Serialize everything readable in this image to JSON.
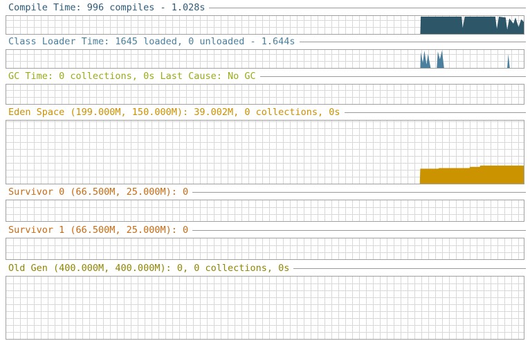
{
  "theme": {
    "grid_color": "#d8d8d8",
    "frame_color": "#a0a0a0"
  },
  "panels": [
    {
      "id": "compile-time",
      "title": "Compile Time: 996 compiles - 1.028s",
      "title_color": "#2d5a78",
      "fill_color": "#2e5669",
      "series": {
        "kind": "spikes",
        "description_note": "",
        "segments": [
          [
            0.0,
            0.0
          ],
          [
            0.8,
            0.0
          ],
          [
            0.801,
            1.0
          ],
          [
            0.88,
            1.0
          ],
          [
            0.882,
            0.35
          ],
          [
            0.886,
            1.0
          ],
          [
            0.945,
            1.0
          ],
          [
            0.948,
            0.3
          ],
          [
            0.952,
            1.0
          ],
          [
            0.965,
            0.95
          ],
          [
            0.968,
            0.25
          ],
          [
            0.972,
            0.9
          ],
          [
            0.98,
            0.6
          ],
          [
            0.984,
            0.95
          ],
          [
            0.99,
            0.4
          ],
          [
            0.995,
            0.85
          ],
          [
            1.0,
            0.7
          ]
        ]
      }
    },
    {
      "id": "class-loader-time",
      "title": "Class Loader Time: 1645 loaded, 0 unloaded - 1.644s",
      "title_color": "#4a7f9e",
      "fill_color": "#4a7f9e",
      "series": {
        "kind": "spikes",
        "description_note": "",
        "segments": [
          [
            0.0,
            0.0
          ],
          [
            0.8,
            0.0
          ],
          [
            0.801,
            0.9
          ],
          [
            0.805,
            0.3
          ],
          [
            0.808,
            1.0
          ],
          [
            0.812,
            0.2
          ],
          [
            0.815,
            0.8
          ],
          [
            0.82,
            0.0
          ],
          [
            0.832,
            0.0
          ],
          [
            0.834,
            0.95
          ],
          [
            0.838,
            0.5
          ],
          [
            0.842,
            1.0
          ],
          [
            0.846,
            0.0
          ],
          [
            0.968,
            0.0
          ],
          [
            0.97,
            0.8
          ],
          [
            0.973,
            0.0
          ],
          [
            1.0,
            0.0
          ]
        ]
      }
    },
    {
      "id": "gc-time",
      "title": "GC Time: 0 collections, 0s Last Cause: No GC",
      "title_color": "#9aab1a",
      "fill_color": "#9aab1a",
      "series": {
        "kind": "empty",
        "segments": []
      }
    },
    {
      "id": "eden-space",
      "title": "Eden Space (199.000M, 150.000M): 39.002M, 0 collections, 0s",
      "title_color": "#cc9000",
      "fill_color": "#cc9300",
      "series": {
        "kind": "steps",
        "segments": [
          [
            0.0,
            0.0
          ],
          [
            0.799,
            0.0
          ],
          [
            0.8,
            0.24
          ],
          [
            0.835,
            0.24
          ],
          [
            0.836,
            0.25
          ],
          [
            0.895,
            0.25
          ],
          [
            0.896,
            0.27
          ],
          [
            0.915,
            0.27
          ],
          [
            0.916,
            0.29
          ],
          [
            1.0,
            0.29
          ]
        ]
      }
    },
    {
      "id": "survivor-0",
      "title": "Survivor 0 (66.500M, 25.000M): 0",
      "title_color": "#c86a10",
      "fill_color": "#c86a10",
      "series": {
        "kind": "empty",
        "segments": []
      }
    },
    {
      "id": "survivor-1",
      "title": "Survivor 1 (66.500M, 25.000M): 0",
      "title_color": "#c86a10",
      "fill_color": "#c86a10",
      "series": {
        "kind": "empty",
        "segments": []
      }
    },
    {
      "id": "old-gen",
      "title": "Old Gen (400.000M, 400.000M): 0, 0 collections, 0s",
      "title_color": "#8f8500",
      "fill_color": "#8f8500",
      "series": {
        "kind": "empty",
        "segments": []
      }
    }
  ]
}
